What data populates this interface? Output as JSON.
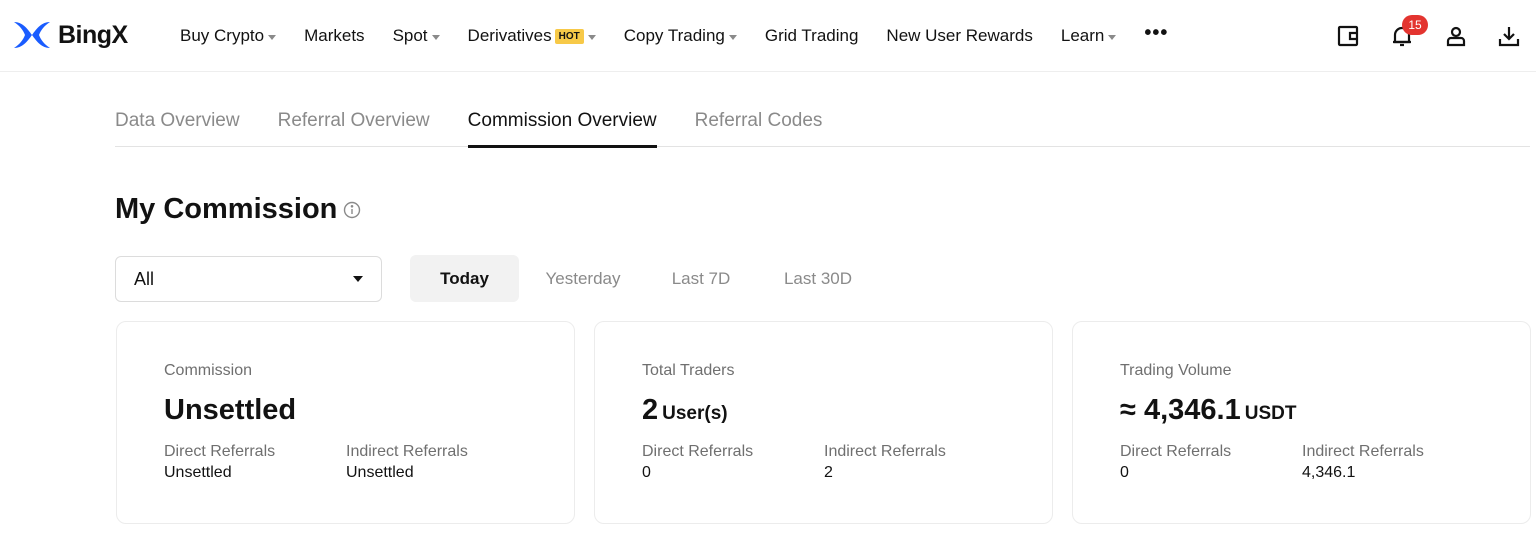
{
  "brand": {
    "name": "BingX",
    "color": "#1a5cff"
  },
  "nav": {
    "items": [
      {
        "label": "Buy Crypto",
        "dropdown": true,
        "hot": false
      },
      {
        "label": "Markets",
        "dropdown": false,
        "hot": false
      },
      {
        "label": "Spot",
        "dropdown": true,
        "hot": false
      },
      {
        "label": "Derivatives",
        "dropdown": true,
        "hot": true
      },
      {
        "label": "Copy Trading",
        "dropdown": true,
        "hot": false
      },
      {
        "label": "Grid Trading",
        "dropdown": false,
        "hot": false
      },
      {
        "label": "New User Rewards",
        "dropdown": false,
        "hot": false
      },
      {
        "label": "Learn",
        "dropdown": true,
        "hot": false
      }
    ],
    "hot_label": "HOT",
    "more_label": "•••"
  },
  "header_icons": {
    "wallet": "wallet-icon",
    "notifications": "bell-icon",
    "notification_count": "15",
    "account": "user-icon",
    "download": "download-icon"
  },
  "tabs": [
    {
      "label": "Data Overview",
      "active": false
    },
    {
      "label": "Referral Overview",
      "active": false
    },
    {
      "label": "Commission Overview",
      "active": true
    },
    {
      "label": "Referral Codes",
      "active": false
    }
  ],
  "section": {
    "title": "My Commission"
  },
  "filters": {
    "type_select": "All",
    "periods": [
      "Today",
      "Yesterday",
      "Last 7D",
      "Last 30D"
    ],
    "active_period": "Today"
  },
  "cards": [
    {
      "label": "Commission",
      "value": "Unsettled",
      "unit": "",
      "direct_label": "Direct Referrals",
      "direct_value": "Unsettled",
      "indirect_label": "Indirect Referrals",
      "indirect_value": "Unsettled"
    },
    {
      "label": "Total Traders",
      "value": "2",
      "unit": "User(s)",
      "direct_label": "Direct Referrals",
      "direct_value": "0",
      "indirect_label": "Indirect Referrals",
      "indirect_value": "2"
    },
    {
      "label": "Trading Volume",
      "value": "≈ 4,346.1",
      "unit": "USDT",
      "direct_label": "Direct Referrals",
      "direct_value": "0",
      "indirect_label": "Indirect Referrals",
      "indirect_value": "4,346.1"
    }
  ]
}
